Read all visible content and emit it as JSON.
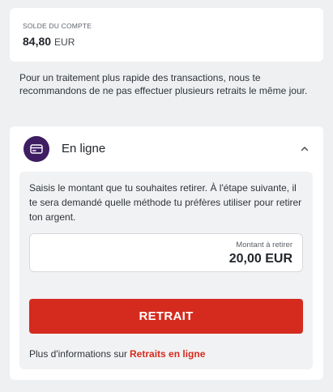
{
  "balance": {
    "label": "SOLDE DU COMPTE",
    "amount": "84,80",
    "currency": "EUR"
  },
  "notice": "Pour un traitement plus rapide des transactions, nous te recommandons de ne pas effectuer plusieurs retraits le même jour.",
  "method": {
    "title": "En ligne",
    "icon": "card-icon",
    "expanded": true,
    "instructions": "Saisis le montant que tu souhaites retirer. À l'étape suivante, il te sera demandé quelle méthode tu préfères utiliser pour retirer ton argent.",
    "amount_field": {
      "label": "Montant à retirer",
      "value": "20,00 EUR"
    },
    "button_label": "RETRAIT",
    "more_info_text": "Plus d'informations sur",
    "more_info_link": "Retraits en ligne"
  },
  "colors": {
    "accent": "#d52b1e",
    "icon_bg": "#3e1d63",
    "page_bg": "#eef0f2"
  }
}
